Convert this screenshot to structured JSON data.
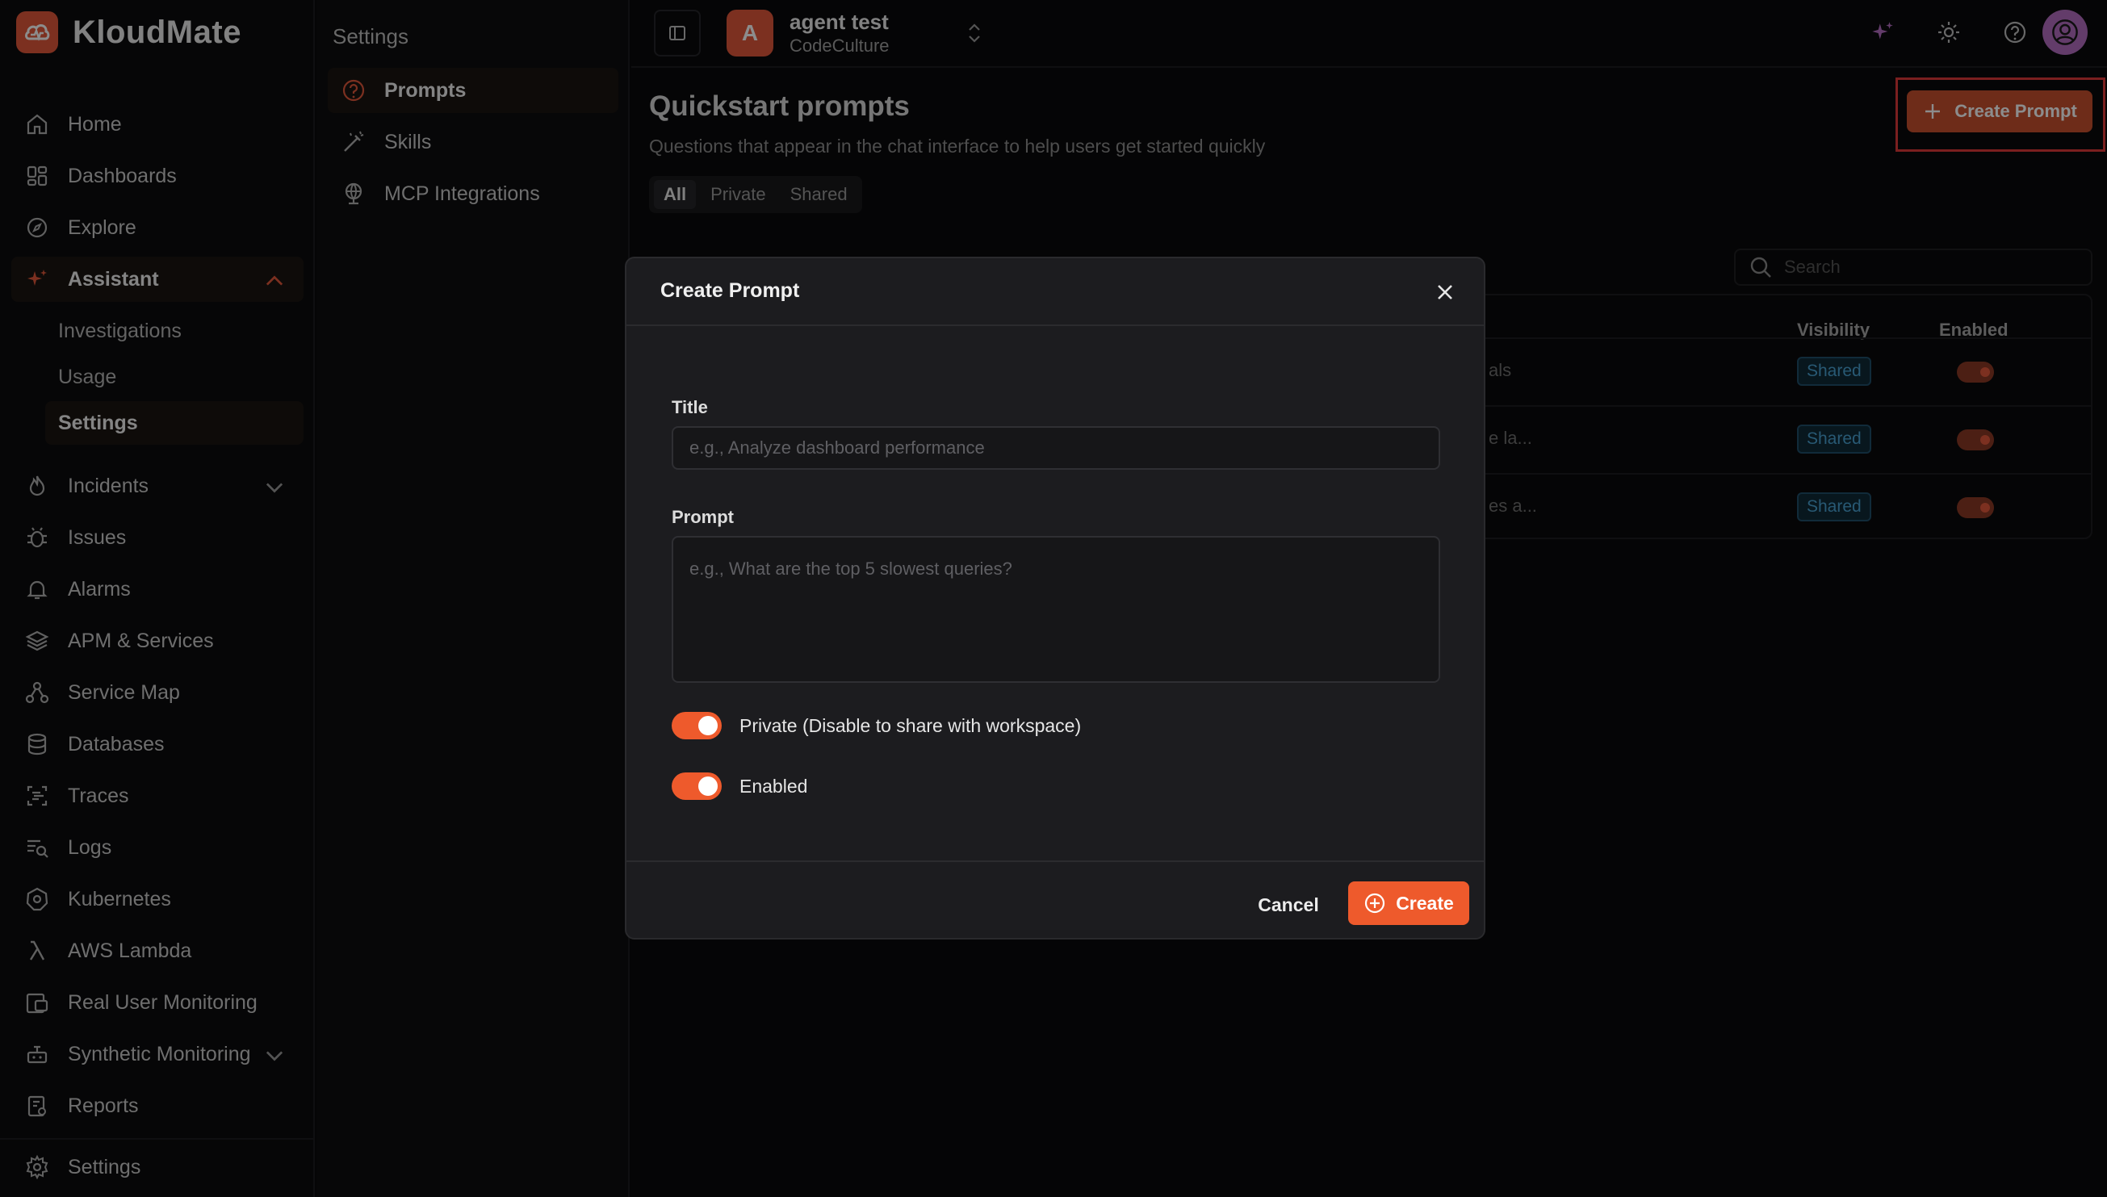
{
  "brand": {
    "name": "KloudMate",
    "accent": "#e2583b"
  },
  "sidebar": {
    "items": [
      {
        "label": "Home",
        "icon": "home-icon"
      },
      {
        "label": "Dashboards",
        "icon": "dashboards-icon"
      },
      {
        "label": "Explore",
        "icon": "compass-icon"
      },
      {
        "label": "Assistant",
        "icon": "sparkle-icon"
      },
      {
        "label": "Incidents",
        "icon": "flame-icon"
      },
      {
        "label": "Issues",
        "icon": "bug-icon"
      },
      {
        "label": "Alarms",
        "icon": "bell-icon"
      },
      {
        "label": "APM & Services",
        "icon": "layers-icon"
      },
      {
        "label": "Service Map",
        "icon": "service-map-icon"
      },
      {
        "label": "Databases",
        "icon": "database-icon"
      },
      {
        "label": "Traces",
        "icon": "traces-icon"
      },
      {
        "label": "Logs",
        "icon": "logs-icon"
      },
      {
        "label": "Kubernetes",
        "icon": "kubernetes-icon"
      },
      {
        "label": "AWS Lambda",
        "icon": "lambda-icon"
      },
      {
        "label": "Real User Monitoring",
        "icon": "rum-icon"
      },
      {
        "label": "Synthetic Monitoring",
        "icon": "robot-icon"
      },
      {
        "label": "Reports",
        "icon": "reports-icon"
      }
    ],
    "assistant_sub": [
      "Investigations",
      "Usage",
      "Settings"
    ],
    "footer_settings": "Settings"
  },
  "settings_nav": {
    "title": "Settings",
    "items": [
      {
        "label": "Prompts",
        "icon": "question-circle-icon"
      },
      {
        "label": "Skills",
        "icon": "wand-icon"
      },
      {
        "label": "MCP Integrations",
        "icon": "globe-icon"
      }
    ]
  },
  "topbar": {
    "workspace_initial": "A",
    "workspace_name": "agent test",
    "workspace_org": "CodeCulture"
  },
  "main": {
    "title": "Quickstart prompts",
    "description": "Questions that appear in the chat interface to help users get started quickly",
    "filters": [
      "All",
      "Private",
      "Shared"
    ],
    "create_button": "Create Prompt",
    "search_placeholder": "Search",
    "columns": {
      "visibility": "Visibility",
      "enabled": "Enabled"
    },
    "rows": [
      {
        "text_tail": "als",
        "visibility": "Shared",
        "enabled": true
      },
      {
        "text_tail": "e la...",
        "visibility": "Shared",
        "enabled": true
      },
      {
        "text_tail": "es a...",
        "visibility": "Shared",
        "enabled": true
      }
    ]
  },
  "modal": {
    "title": "Create Prompt",
    "title_label": "Title",
    "title_placeholder": "e.g., Analyze dashboard performance",
    "prompt_label": "Prompt",
    "prompt_placeholder": "e.g., What are the top 5 slowest queries?",
    "private_label": "Private (Disable to share with workspace)",
    "private_on": true,
    "enabled_label": "Enabled",
    "enabled_on": true,
    "cancel_label": "Cancel",
    "create_label": "Create"
  }
}
